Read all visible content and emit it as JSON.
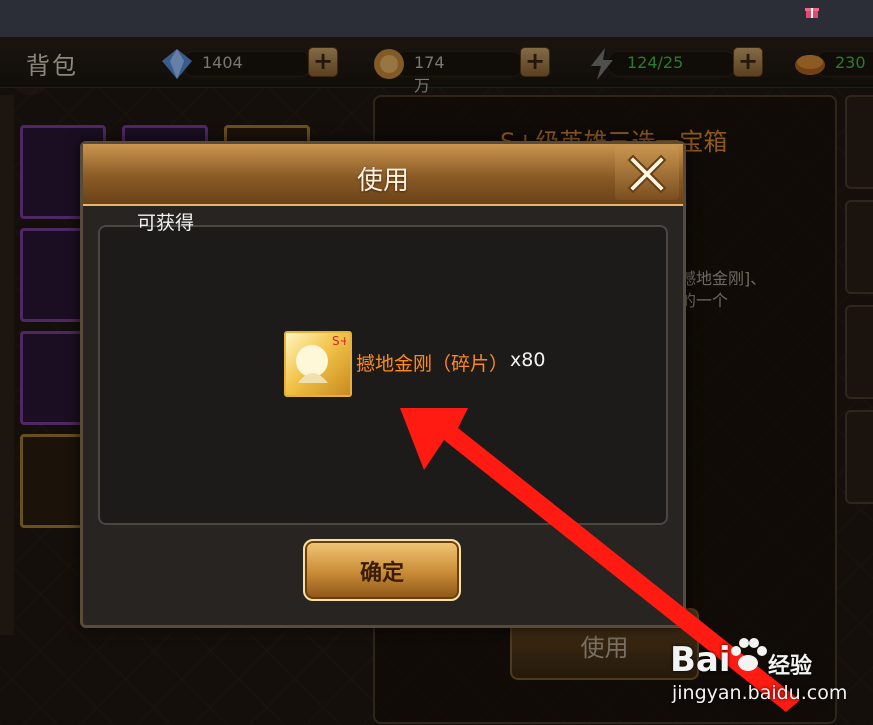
{
  "top_bar": {
    "gift_icon": "gift-icon"
  },
  "header": {
    "bag_title": "背包"
  },
  "resources": [
    {
      "icon": "diamond-icon",
      "value": "1404",
      "plus": "+"
    },
    {
      "icon": "coin-icon",
      "value": "174万",
      "plus": "+"
    },
    {
      "icon": "lightning-icon",
      "value": "124/25",
      "plus": "+",
      "color": "#3fbf3f"
    },
    {
      "icon": "bread-icon",
      "value": "230",
      "color": "#3fbf3f"
    }
  ],
  "detail_panel": {
    "title": "S+级英雄三选一宝箱",
    "desc": "撼地金刚]、\n的一个",
    "use_button": "使用"
  },
  "modal": {
    "title": "使用",
    "close_icon": "close-icon",
    "reward_label": "可获得",
    "reward_name": "撼地金刚（碎片）",
    "reward_qty": "x80",
    "confirm_button": "确定"
  },
  "watermark": {
    "logo": "Bai",
    "brand": "经验",
    "url": "jingyan.baidu.com"
  },
  "colors": {
    "accent": "#d88a2a",
    "reward_name": "#ff8a1a",
    "arrow": "#ff1a12"
  }
}
